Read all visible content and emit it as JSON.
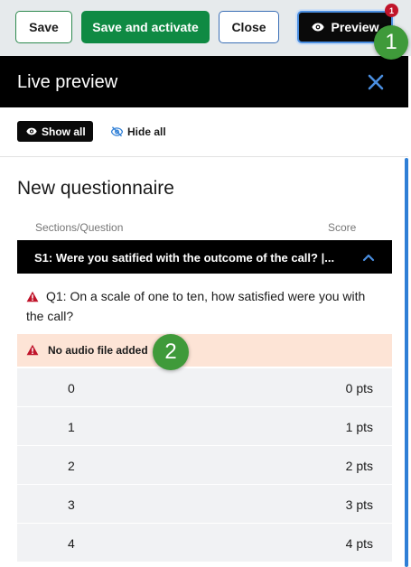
{
  "toolbar": {
    "save_label": "Save",
    "save_activate_label": "Save and activate",
    "close_label": "Close",
    "preview_label": "Preview",
    "preview_badge": "1"
  },
  "callouts": {
    "first": "1",
    "second": "2"
  },
  "live_preview": {
    "title": "Live preview",
    "show_all_label": "Show all",
    "hide_all_label": "Hide all"
  },
  "questionnaire": {
    "title": "New questionnaire",
    "col_section": "Sections/Question",
    "col_score": "Score",
    "section_label": "S1: Were you satified with the outcome of the call? |...",
    "question_text": "Q1: On a scale of one to ten, how satisfied were you with the call?",
    "audio_warning": "No audio file added",
    "answers": [
      {
        "value": "0",
        "points": "0 pts"
      },
      {
        "value": "1",
        "points": "1 pts"
      },
      {
        "value": "2",
        "points": "2 pts"
      },
      {
        "value": "3",
        "points": "3 pts"
      },
      {
        "value": "4",
        "points": "4 pts"
      }
    ]
  },
  "colors": {
    "primary_green": "#0f8a43",
    "accent_blue": "#2f7fd6",
    "warning_red": "#c0142a",
    "warning_bg": "#fde4d6"
  },
  "icons": [
    "eye-icon",
    "close-icon",
    "eye-slash-icon",
    "chevron-up-icon",
    "warning-icon"
  ]
}
